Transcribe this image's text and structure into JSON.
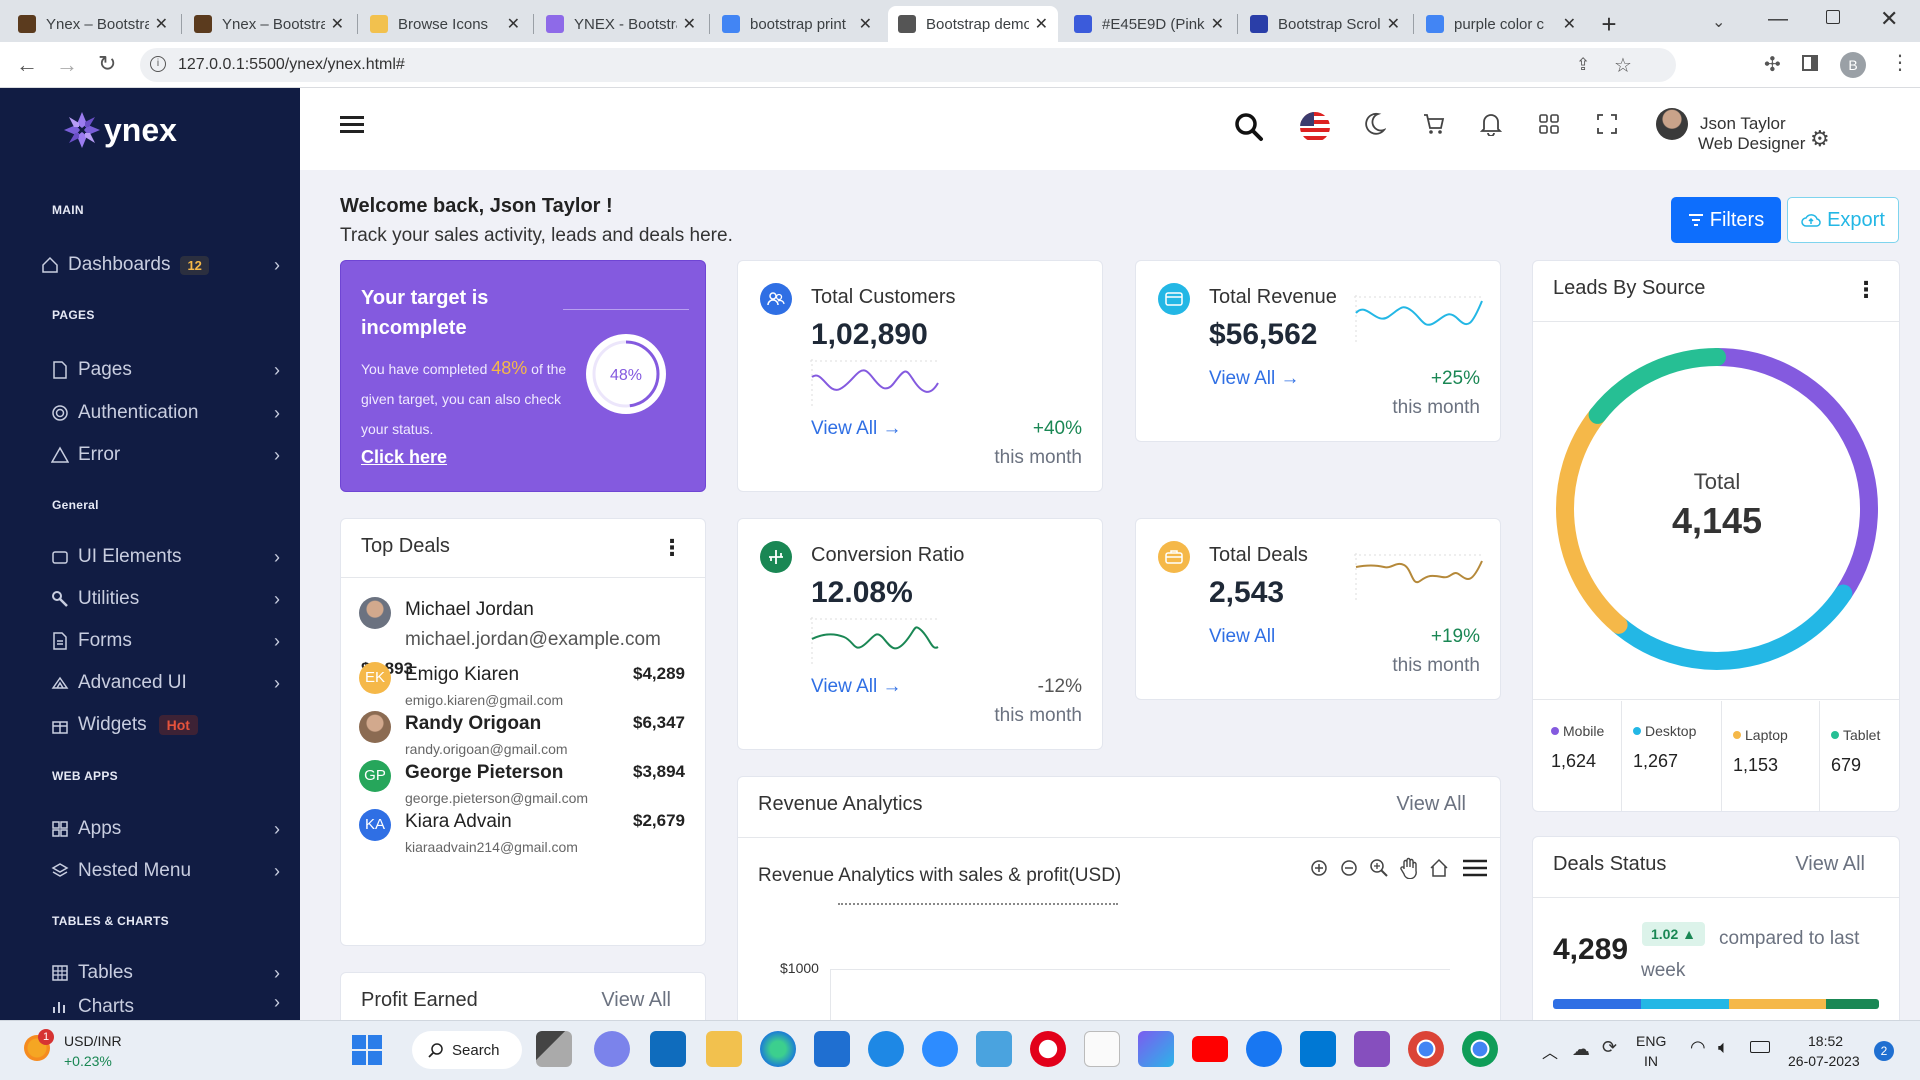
{
  "browser": {
    "tabs": [
      {
        "title": "Ynex – Bootstrap",
        "active": false
      },
      {
        "title": "Ynex – Bootstrap",
        "active": false
      },
      {
        "title": "Browse Icons",
        "active": false
      },
      {
        "title": "YNEX - Bootstrap",
        "active": false
      },
      {
        "title": "bootstrap print",
        "active": false
      },
      {
        "title": "Bootstrap demo",
        "active": true
      },
      {
        "title": "#E45E9D (Pink",
        "active": false
      },
      {
        "title": "Bootstrap Scroll",
        "active": false
      },
      {
        "title": "purple color c",
        "active": false
      }
    ],
    "url": "127.0.0.1:5500/ynex/ynex.html#",
    "profile_initial": "B"
  },
  "sidebar": {
    "brand": "ynex",
    "sections": {
      "main": "MAIN",
      "pages": "PAGES",
      "general": "General",
      "web_apps": "WEB APPS",
      "tables_charts": "TABLES & CHARTS"
    },
    "dashboards": {
      "label": "Dashboards",
      "badge": "12"
    },
    "pages_items": [
      "Pages",
      "Authentication",
      "Error"
    ],
    "general_items": [
      "UI Elements",
      "Utilities",
      "Forms",
      "Advanced UI",
      "Widgets"
    ],
    "widgets_badge": "Hot",
    "webapps_items": [
      "Apps",
      "Nested Menu"
    ],
    "tables_items": [
      "Tables",
      "Charts"
    ]
  },
  "header": {
    "user_name": "Json Taylor",
    "user_role": "Web Designer"
  },
  "welcome": {
    "title": "Welcome back, Json Taylor !",
    "subtitle": "Track your sales activity, leads and deals here.",
    "filters": "Filters",
    "export": "Export"
  },
  "target": {
    "title": "Your target is incomplete",
    "text_a": "You have completed",
    "pct": "48%",
    "text_b": "of the given target, you can also check your status.",
    "link": "Click here",
    "percent_value": 48
  },
  "stats": [
    {
      "title": "Total Customers",
      "value": "1,02,890",
      "link": "View All →",
      "change": "+40%",
      "period": "this month",
      "color": "#2f6fe4"
    },
    {
      "title": "Total Revenue",
      "value": "$56,562",
      "link": "View All →",
      "change": "+25%",
      "period": "this month",
      "color": "#23b7e5"
    },
    {
      "title": "Conversion Ratio",
      "value": "12.08%",
      "link": "View All →",
      "change": "-12%",
      "period": "this month",
      "color": "#1a8754"
    },
    {
      "title": "Total Deals",
      "value": "2,543",
      "link": "View All",
      "change": "+19%",
      "period": "this month",
      "color": "#f5b849"
    }
  ],
  "top_deals": {
    "title": "Top Deals",
    "items": [
      {
        "name": "Michael Jordan",
        "email": "michael.jordan@example.com",
        "amount": "$2,893",
        "avatar": "photo",
        "color": "#6b7280"
      },
      {
        "name": "Emigo Kiaren",
        "email": "emigo.kiaren@gmail.com",
        "amount": "$4,289",
        "avatar": "EK",
        "color": "#f5b849"
      },
      {
        "name": "Randy Origoan",
        "email": "randy.origoan@gmail.com",
        "amount": "$6,347",
        "avatar": "photo",
        "color": "#8b6b52"
      },
      {
        "name": "George Pieterson",
        "email": "george.pieterson@gmail.com",
        "amount": "$3,894",
        "avatar": "GP",
        "color": "#26a65b"
      },
      {
        "name": "Kiara Advain",
        "email": "kiaraadvain214@gmail.com",
        "amount": "$2,679",
        "avatar": "KA",
        "color": "#2f6fe4"
      }
    ]
  },
  "profit": {
    "title": "Profit Earned",
    "link": "View All"
  },
  "revenue": {
    "title": "Revenue Analytics",
    "link": "View All",
    "chart_title": "Revenue Analytics with sales & profit(USD)",
    "y_tick": "$1000"
  },
  "leads": {
    "title": "Leads By Source",
    "total_label": "Total",
    "total_value": "4,145",
    "legend": [
      {
        "label": "Mobile",
        "value": "1,624",
        "color": "#845adf"
      },
      {
        "label": "Desktop",
        "value": "1,267",
        "color": "#23b7e5"
      },
      {
        "label": "Laptop",
        "value": "1,153",
        "color": "#f5b849"
      },
      {
        "label": "Tablet",
        "value": "679",
        "color": "#26bf94"
      }
    ]
  },
  "deals_status": {
    "title": "Deals Status",
    "link": "View All",
    "value": "4,289",
    "delta": "1.02 ▲",
    "compare": "compared to last week"
  },
  "taskbar": {
    "ticker": "USD/INR",
    "ticker_change": "+0.23%",
    "notif": "1",
    "search": "Search",
    "lang1": "ENG",
    "lang2": "IN",
    "time": "18:52",
    "date": "26-07-2023",
    "badge": "2"
  }
}
